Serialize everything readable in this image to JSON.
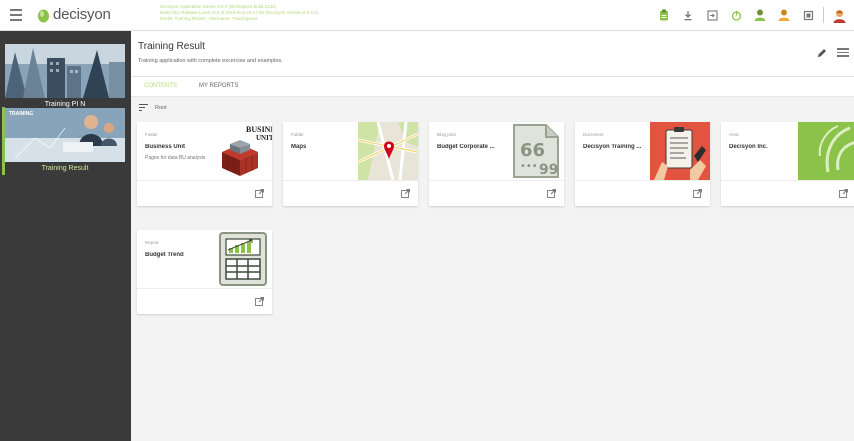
{
  "topbar": {
    "logo_text": "decisyon",
    "sysinfo": [
      "Decisyon Application Server 3.0.0 (Workspace build 1234)",
      "Build Info: Release Lorem 5.0 of 2016-Nov-23 17:06 (Decisyon Version 6.5.4.1)",
      "Model: Training Result · Username: TrainingUser"
    ],
    "icons": [
      "clipboard-icon",
      "download-icon",
      "login-icon",
      "power-icon",
      "user-green-icon",
      "user-orange-icon",
      "screen-icon",
      "avatar-icon"
    ]
  },
  "sidebar": {
    "apps": [
      {
        "label": "Training PI N",
        "tag": ""
      },
      {
        "label": "Training Result",
        "tag": "TRAINING"
      }
    ]
  },
  "header": {
    "title": "Training Result",
    "subtitle": "Training application with complete excercise and examples."
  },
  "tabs": [
    {
      "label": "CONTENTS"
    },
    {
      "label": "MY REPORTS"
    }
  ],
  "breadcrumb": {
    "label": "Root"
  },
  "cards": [
    {
      "type": "Folder",
      "name": "Business Unit",
      "desc": "Pages for data BU analysis"
    },
    {
      "type": "Folder",
      "name": "Maps",
      "desc": ""
    },
    {
      "type": "Blog post",
      "name": "Budget Corporate ...",
      "desc": ""
    },
    {
      "type": "Document",
      "name": "Decisyon Training ...",
      "desc": ""
    },
    {
      "type": "Area",
      "name": "Decisyon Inc.",
      "desc": ""
    },
    {
      "type": "Report",
      "name": "Budget Trend",
      "desc": ""
    }
  ],
  "colors": {
    "accent": "#8bc34a",
    "sidebar": "#3a3a3a",
    "tab_active": "#b7dd7a"
  }
}
